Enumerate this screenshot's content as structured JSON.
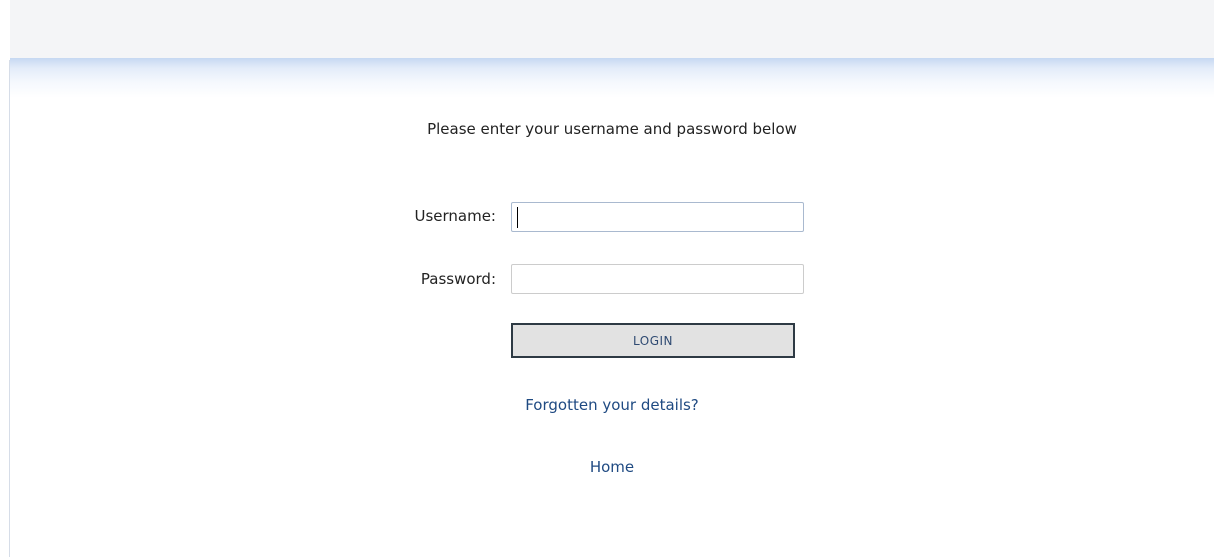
{
  "login": {
    "intro": "Please enter your username and password below",
    "username_label": "Username:",
    "username_value": "",
    "password_label": "Password:",
    "password_value": "",
    "button_label": "LOGIN"
  },
  "links": {
    "forgotten": "Forgotten your details?",
    "home": "Home"
  },
  "colors": {
    "link": "#1f4a82",
    "button_bg": "#e2e2e2",
    "button_border": "#2e3a44",
    "header_band": "#f4f5f7",
    "header_gradient": "#c6d8f2"
  }
}
